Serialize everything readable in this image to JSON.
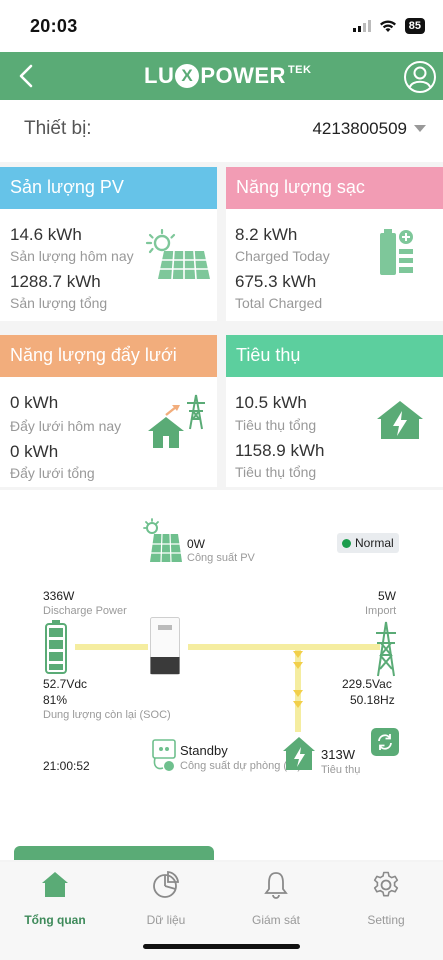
{
  "status_bar": {
    "time": "20:03",
    "battery": "85"
  },
  "header": {
    "logo_left": "LU",
    "logo_x": "X",
    "logo_right": "POWER",
    "logo_sup": "TEK"
  },
  "device": {
    "label": "Thiết bị:",
    "serial": "4213800509"
  },
  "cards": {
    "pv": {
      "title": "Sản lượng PV",
      "today_value": "14.6 kWh",
      "today_label": "Sản lượng hôm nay",
      "total_value": "1288.7 kWh",
      "total_label": "Sản lượng tổng",
      "color": "#66c3e8"
    },
    "charge": {
      "title": "Năng lượng sạc",
      "today_value": "8.2 kWh",
      "today_label": "Charged Today",
      "total_value": "675.3 kWh",
      "total_label": "Total Charged",
      "color": "#f29cb4"
    },
    "export": {
      "title": "Năng lượng đẩy lưới",
      "today_value": "0 kWh",
      "today_label": "Đẩy lưới hôm nay",
      "total_value": "0 kWh",
      "total_label": "Đẩy lưới tổng",
      "color": "#f2ad7c"
    },
    "consumption": {
      "title": "Tiêu thụ",
      "today_value": "10.5 kWh",
      "today_label": "Tiêu thụ tổng",
      "total_value": "1158.9 kWh",
      "total_label": "Tiêu thụ tổng",
      "color": "#5ccf9e"
    }
  },
  "flow": {
    "pv_power": "0W",
    "pv_label": "Công suất PV",
    "status": "Normal",
    "battery_power": "336W",
    "battery_power_label": "Discharge Power",
    "battery_voltage": "52.7Vdc",
    "battery_soc": "81%",
    "battery_soc_label": "Dung lượng còn lại (SOC)",
    "grid_power": "5W",
    "grid_label": "Import",
    "grid_voltage": "229.5Vac",
    "grid_freq": "50.18Hz",
    "time": "21:00:52",
    "backup_status": "Standby",
    "backup_label": "Công suất dự phòng (W)",
    "load_power": "313W",
    "load_label": "Tiêu thụ"
  },
  "tabs": [
    {
      "label": "Tổng quan",
      "icon": "home-icon"
    },
    {
      "label": "Dữ liệu",
      "icon": "pie-chart-icon"
    },
    {
      "label": "Giám sát",
      "icon": "bell-icon"
    },
    {
      "label": "Setting",
      "icon": "gear-icon"
    }
  ],
  "colors": {
    "accent": "#5aab76",
    "flow_line": "#f5eda0",
    "flow_arrow": "#f2cf4a"
  }
}
